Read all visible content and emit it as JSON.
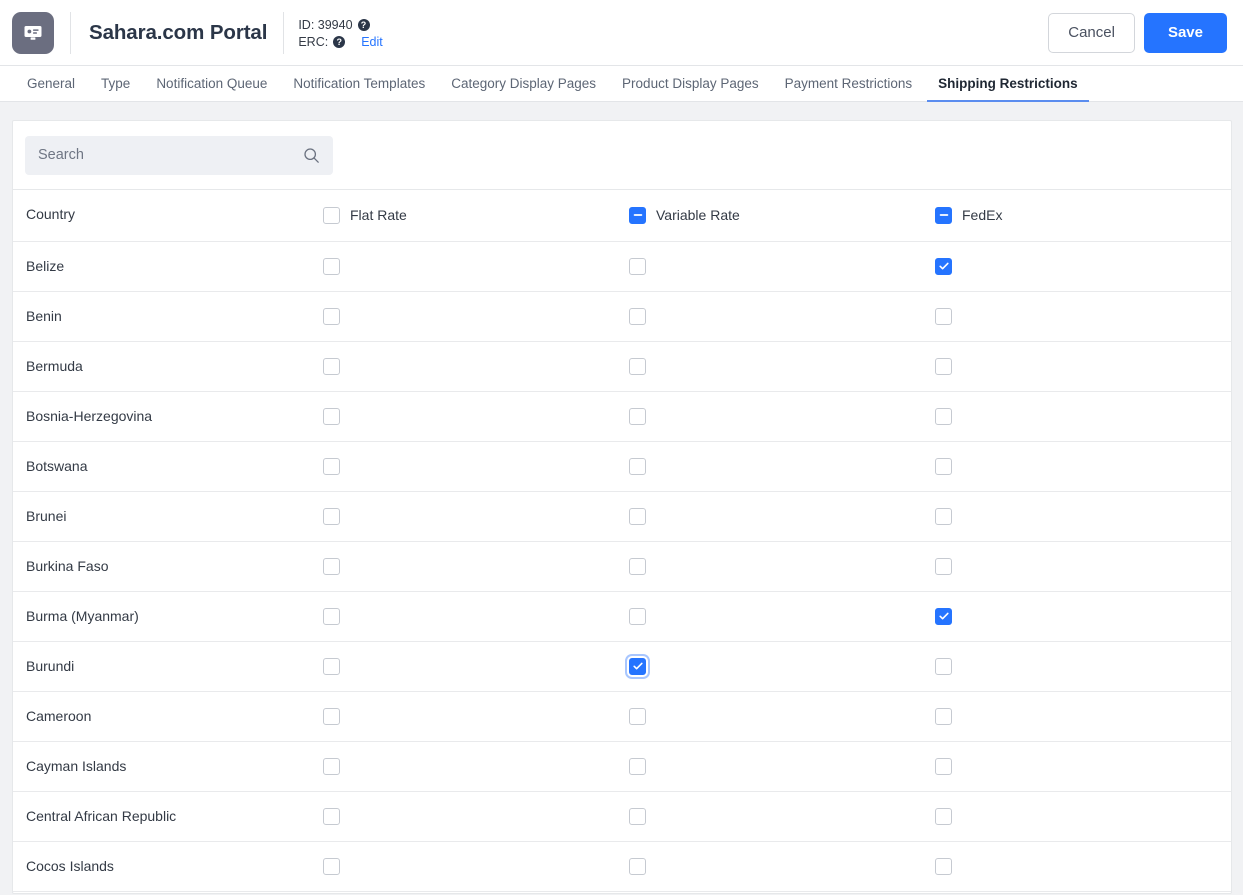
{
  "header": {
    "logo_icon": "portal-monitor-icon",
    "title": "Sahara.com Portal",
    "id_label": "ID: 39940",
    "erc_label": "ERC:",
    "help_glyph": "?",
    "edit_label": "Edit",
    "cancel_label": "Cancel",
    "save_label": "Save",
    "accent_color": "#2574ff",
    "logo_bg": "#6b6e80"
  },
  "tabs": [
    {
      "label": "General",
      "active": false
    },
    {
      "label": "Type",
      "active": false
    },
    {
      "label": "Notification Queue",
      "active": false
    },
    {
      "label": "Notification Templates",
      "active": false
    },
    {
      "label": "Category Display Pages",
      "active": false
    },
    {
      "label": "Product Display Pages",
      "active": false
    },
    {
      "label": "Payment Restrictions",
      "active": false
    },
    {
      "label": "Shipping Restrictions",
      "active": true
    }
  ],
  "search": {
    "value": "",
    "placeholder": "Search",
    "icon": "search-icon"
  },
  "table": {
    "columns": [
      {
        "key": "country",
        "label": "Country",
        "type": "text"
      },
      {
        "key": "flat_rate",
        "label": "Flat Rate",
        "type": "checkbox",
        "header_state": "unchecked"
      },
      {
        "key": "variable_rate",
        "label": "Variable Rate",
        "type": "checkbox",
        "header_state": "indeterminate"
      },
      {
        "key": "fedex",
        "label": "FedEx",
        "type": "checkbox",
        "header_state": "indeterminate"
      }
    ],
    "rows": [
      {
        "country": "Belize",
        "flat_rate": "unchecked",
        "variable_rate": "unchecked",
        "fedex": "checked"
      },
      {
        "country": "Benin",
        "flat_rate": "unchecked",
        "variable_rate": "unchecked",
        "fedex": "unchecked"
      },
      {
        "country": "Bermuda",
        "flat_rate": "unchecked",
        "variable_rate": "unchecked",
        "fedex": "unchecked"
      },
      {
        "country": "Bosnia-Herzegovina",
        "flat_rate": "unchecked",
        "variable_rate": "unchecked",
        "fedex": "unchecked"
      },
      {
        "country": "Botswana",
        "flat_rate": "unchecked",
        "variable_rate": "unchecked",
        "fedex": "unchecked"
      },
      {
        "country": "Brunei",
        "flat_rate": "unchecked",
        "variable_rate": "unchecked",
        "fedex": "unchecked"
      },
      {
        "country": "Burkina Faso",
        "flat_rate": "unchecked",
        "variable_rate": "unchecked",
        "fedex": "unchecked"
      },
      {
        "country": "Burma (Myanmar)",
        "flat_rate": "unchecked",
        "variable_rate": "unchecked",
        "fedex": "checked"
      },
      {
        "country": "Burundi",
        "flat_rate": "unchecked",
        "variable_rate": "checked-focused",
        "fedex": "unchecked"
      },
      {
        "country": "Cameroon",
        "flat_rate": "unchecked",
        "variable_rate": "unchecked",
        "fedex": "unchecked"
      },
      {
        "country": "Cayman Islands",
        "flat_rate": "unchecked",
        "variable_rate": "unchecked",
        "fedex": "unchecked"
      },
      {
        "country": "Central African Republic",
        "flat_rate": "unchecked",
        "variable_rate": "unchecked",
        "fedex": "unchecked"
      },
      {
        "country": "Cocos Islands",
        "flat_rate": "unchecked",
        "variable_rate": "unchecked",
        "fedex": "unchecked"
      }
    ]
  }
}
